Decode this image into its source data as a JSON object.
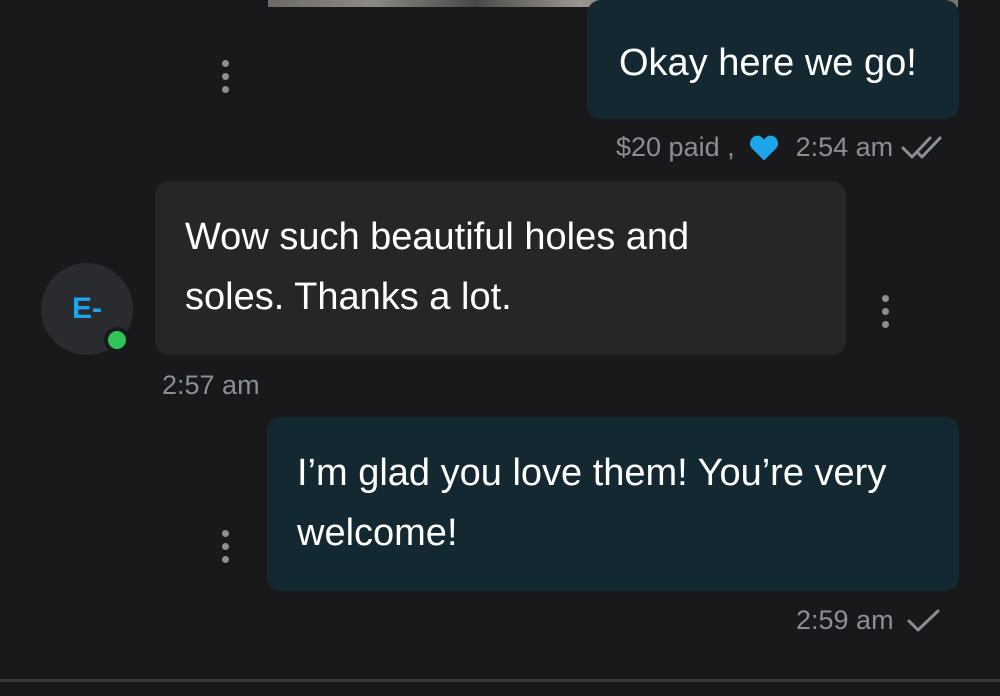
{
  "messages": [
    {
      "direction": "outgoing",
      "text": "Okay here we go!",
      "paid_label": "$20 paid ,",
      "time": "2:54 am",
      "status_icon": "double-check-icon",
      "reaction_icon": "heart-icon"
    },
    {
      "direction": "incoming",
      "line1": "Wow such beautiful holes and",
      "line2": "soles. Thanks a lot.",
      "time": "2:57 am"
    },
    {
      "direction": "outgoing",
      "line1": "I’m glad you love them! You’re very",
      "line2": "welcome!",
      "time": "2:59 am",
      "status_icon": "check-icon"
    }
  ],
  "contact": {
    "initials": "E-",
    "online": true
  },
  "colors": {
    "background": "#19191b",
    "outgoing_bubble": "#132830",
    "incoming_bubble": "#262629",
    "accent": "#1ea4e9",
    "online": "#2fc35a",
    "meta_text": "#8a8f96"
  }
}
